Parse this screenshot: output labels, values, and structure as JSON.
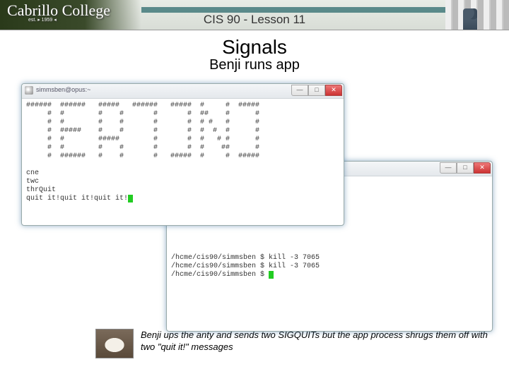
{
  "header": {
    "logo_text": "Cabrillo College",
    "logo_est": "est. ▸ 1959 ◂",
    "course_label": "CIS 90 - Lesson 11"
  },
  "titles": {
    "main": "Signals",
    "sub": "Benji runs app"
  },
  "window_common": {
    "min_glyph": "—",
    "max_glyph": "□",
    "close_glyph": "✕"
  },
  "window1": {
    "title": "simmsben@opus:~",
    "output": "######  ######   #####   ######   #####  #     #  #####\n     #  #        #    #       #       #  ##    #      #\n     #  #        #    #       #       #  # #   #      #\n     #  #####    #    #       #       #  #  #  #      #\n     #  #        #####        #       #  #   # #      #\n     #  #        #    #       #       #  #    ##      #\n     #  ######   #    #       #   #####  #     #  #####\n\ncne\ntwc\nthrQuit\nquit it!quit it!quit it!"
  },
  "window2": {
    "title": "",
    "output": "/hcme/cis90/simmsben $ kill -3 7065\n/hcme/cis90/simmsben $ kill -3 7065\n/hcme/cis90/simmsben $ "
  },
  "caption": "Benji ups the anty and sends two SIGQUITs but the app process shrugs them off with two \"quit it!\" messages"
}
